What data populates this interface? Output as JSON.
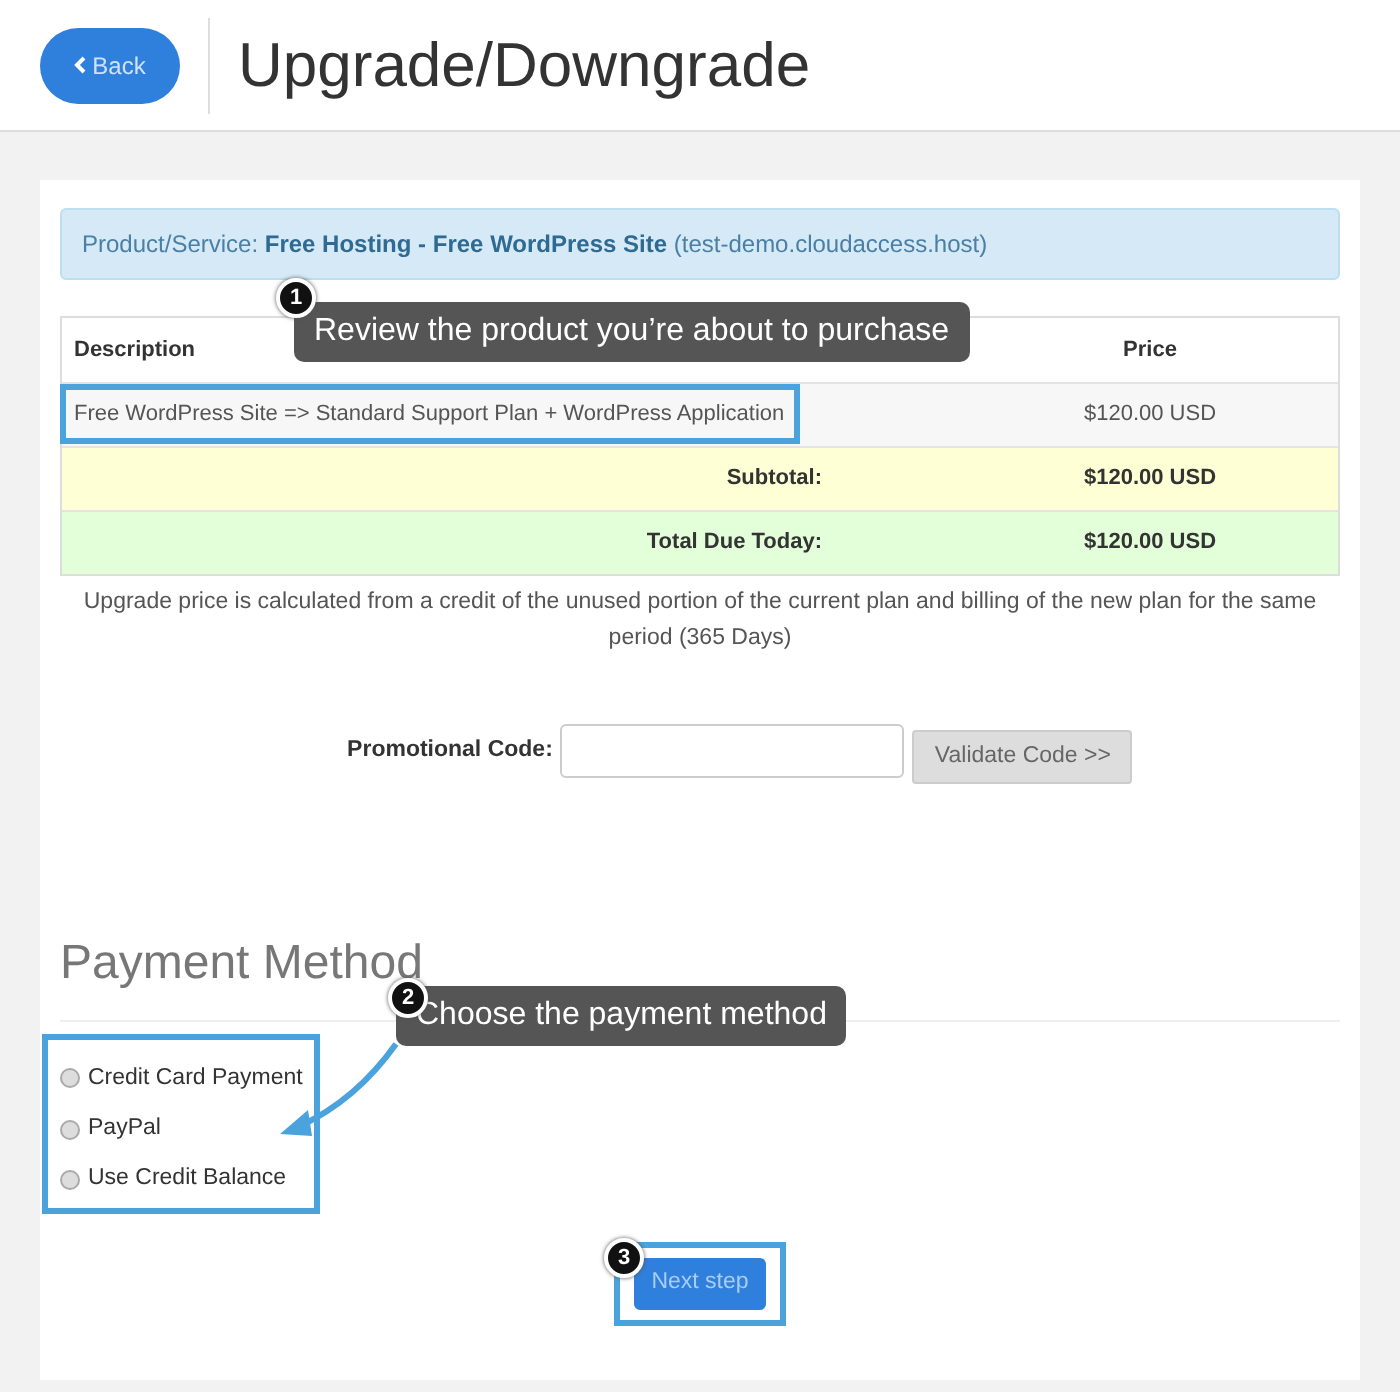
{
  "header": {
    "back_button": "Back",
    "title": "Upgrade/Downgrade"
  },
  "product_alert": {
    "label": "Product/Service:",
    "product": "Free Hosting - Free WordPress Site",
    "domain": "(test-demo.cloudaccess.host)"
  },
  "table": {
    "columns": [
      "Description",
      "Price"
    ],
    "rows": [
      {
        "kind": "item",
        "description": "Free WordPress Site => Standard Support Plan + WordPress Application",
        "price": "$120.00 USD"
      },
      {
        "kind": "subtotal",
        "description": "Subtotal:",
        "price": "$120.00 USD"
      },
      {
        "kind": "total",
        "description": "Total Due Today:",
        "price": "$120.00 USD"
      }
    ]
  },
  "note": "Upgrade price is calculated from a credit of the unused portion of the current plan and billing of the new plan for the same period (365 Days)",
  "promo": {
    "label": "Promotional Code:",
    "validate_button": "Validate Code >>"
  },
  "payment": {
    "title": "Payment Method",
    "options": [
      {
        "label": "Credit Card Payment",
        "selected": false
      },
      {
        "label": "PayPal",
        "selected": false
      },
      {
        "label": "Use Credit Balance",
        "selected": false
      }
    ]
  },
  "next_button": "Next step",
  "annotations": [
    {
      "number": "1",
      "text": "Review the product you’re about to purchase"
    },
    {
      "number": "2",
      "text": "Choose the payment method"
    },
    {
      "number": "3"
    }
  ]
}
